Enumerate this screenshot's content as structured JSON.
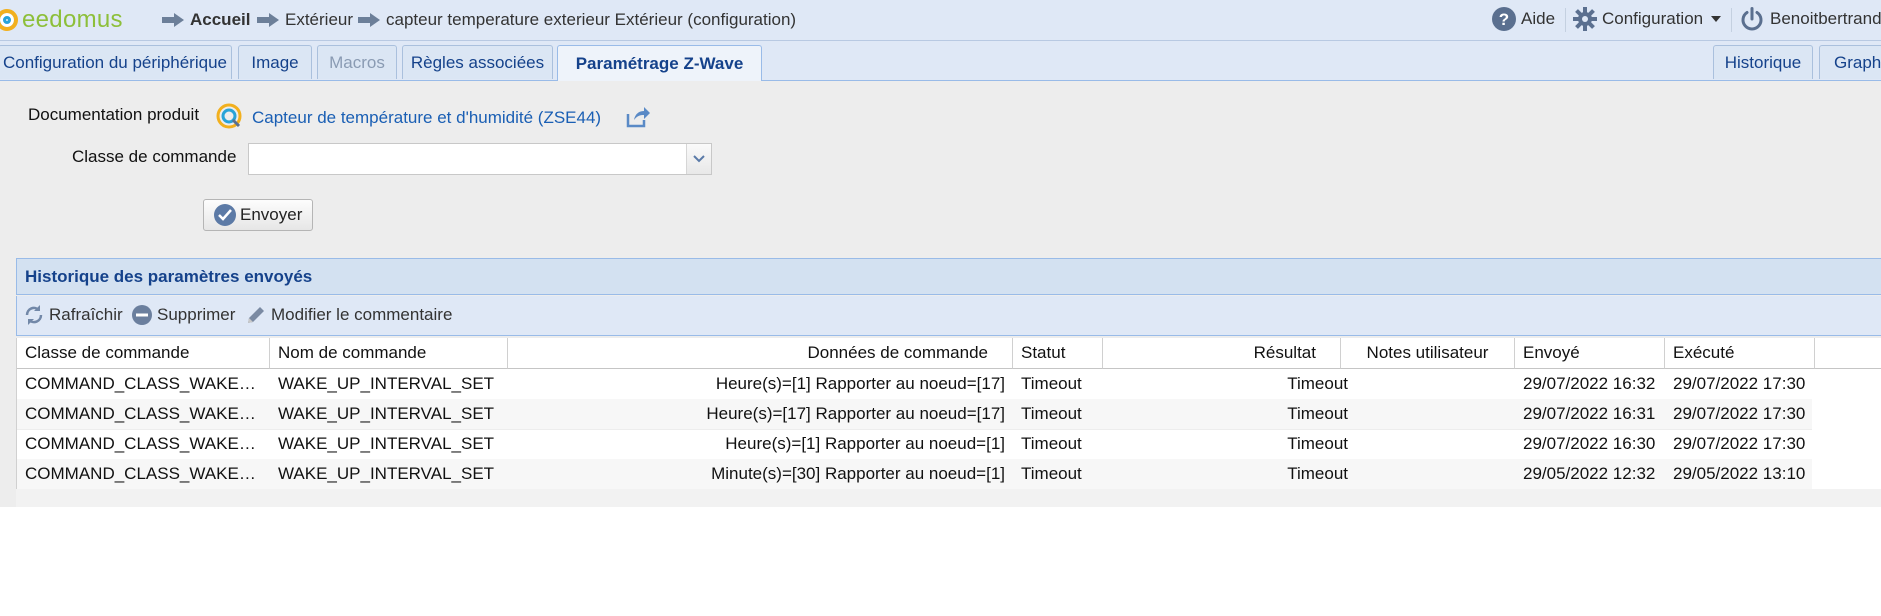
{
  "app": {
    "logo_text": "eedomus",
    "brand_color": "#8dbf3a",
    "accent": "#15428b"
  },
  "breadcrumb": [
    {
      "label": "Accueil",
      "icon": "arrow-right-icon"
    },
    {
      "label": "Extérieur",
      "icon": "arrow-right-icon"
    },
    {
      "label": "capteur temperature exterieur Extérieur (configuration)",
      "icon": "arrow-right-icon"
    }
  ],
  "topnav": {
    "help_label": "Aide",
    "config_label": "Configuration",
    "user_label": "Benoitbertrand"
  },
  "tabs": [
    {
      "label": "Configuration du périphérique",
      "state": "normal"
    },
    {
      "label": "Image",
      "state": "normal"
    },
    {
      "label": "Macros",
      "state": "disabled"
    },
    {
      "label": "Règles associées",
      "state": "normal"
    },
    {
      "label": "Paramétrage Z-Wave",
      "state": "active"
    },
    {
      "label": "Historique",
      "state": "normal"
    },
    {
      "label": "Graphe",
      "state": "normal"
    }
  ],
  "form": {
    "doc_label": "Documentation produit",
    "doc_link": "Capteur de température et d'humidité (ZSE44)",
    "command_class_label": "Classe de commande",
    "command_class_value": "",
    "send_label": "Envoyer"
  },
  "history": {
    "title": "Historique des paramètres envoyés",
    "toolbar": {
      "refresh": "Rafraîchir",
      "delete": "Supprimer",
      "edit_comment": "Modifier le commentaire"
    },
    "columns": [
      "Classe de commande",
      "Nom de commande",
      "Données de commande",
      "Statut",
      "Résultat",
      "Notes utilisateur",
      "Envoyé",
      "Exécuté"
    ],
    "rows": [
      {
        "class": "COMMAND_CLASS_WAKE_UP",
        "name": "WAKE_UP_INTERVAL_SET",
        "data": "Heure(s)=[1] Rapporter au noeud=[17]",
        "status": "Timeout",
        "result": "Timeout",
        "notes": "",
        "sent": "29/07/2022 16:32",
        "executed": "29/07/2022 17:30"
      },
      {
        "class": "COMMAND_CLASS_WAKE_UP",
        "name": "WAKE_UP_INTERVAL_SET",
        "data": "Heure(s)=[17] Rapporter au noeud=[17]",
        "status": "Timeout",
        "result": "Timeout",
        "notes": "",
        "sent": "29/07/2022 16:31",
        "executed": "29/07/2022 17:30"
      },
      {
        "class": "COMMAND_CLASS_WAKE_UP",
        "name": "WAKE_UP_INTERVAL_SET",
        "data": "Heure(s)=[1] Rapporter au noeud=[1]",
        "status": "Timeout",
        "result": "Timeout",
        "notes": "",
        "sent": "29/07/2022 16:30",
        "executed": "29/07/2022 17:30"
      },
      {
        "class": "COMMAND_CLASS_WAKE_UP",
        "name": "WAKE_UP_INTERVAL_SET",
        "data": "Minute(s)=[30] Rapporter au noeud=[1]",
        "status": "Timeout",
        "result": "Timeout",
        "notes": "",
        "sent": "29/05/2022 12:32",
        "executed": "29/05/2022 13:10"
      }
    ]
  }
}
